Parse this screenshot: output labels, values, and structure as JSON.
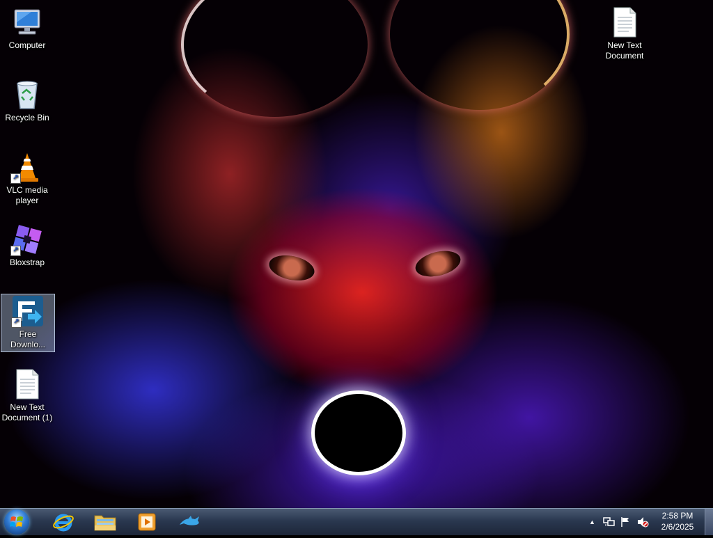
{
  "desktop": {
    "icons": [
      {
        "label": "Computer",
        "icon": "computer-icon"
      },
      {
        "label": "Recycle Bin",
        "icon": "recycle-bin-icon"
      },
      {
        "label": "VLC media player",
        "icon": "vlc-icon"
      },
      {
        "label": "Bloxstrap",
        "icon": "bloxstrap-icon"
      },
      {
        "label": "Free Downlo...",
        "icon": "free-download-manager-icon"
      },
      {
        "label": "New Text Document (1)",
        "icon": "text-document-icon"
      },
      {
        "label": "New Text Document",
        "icon": "text-document-icon"
      }
    ]
  },
  "taskbar": {
    "pinned": [
      "internet-explorer-icon",
      "file-explorer-icon",
      "media-player-icon",
      "dolphin-app-icon"
    ],
    "tray": {
      "show_hidden": "▲",
      "icons": [
        "network-icon",
        "action-center-flag-icon",
        "volume-muted-icon"
      ]
    },
    "clock": {
      "time": "2:58 PM",
      "date": "2/6/2025"
    }
  },
  "colors": {
    "taskbar": "#2a3850",
    "selection": "#aabedc"
  }
}
